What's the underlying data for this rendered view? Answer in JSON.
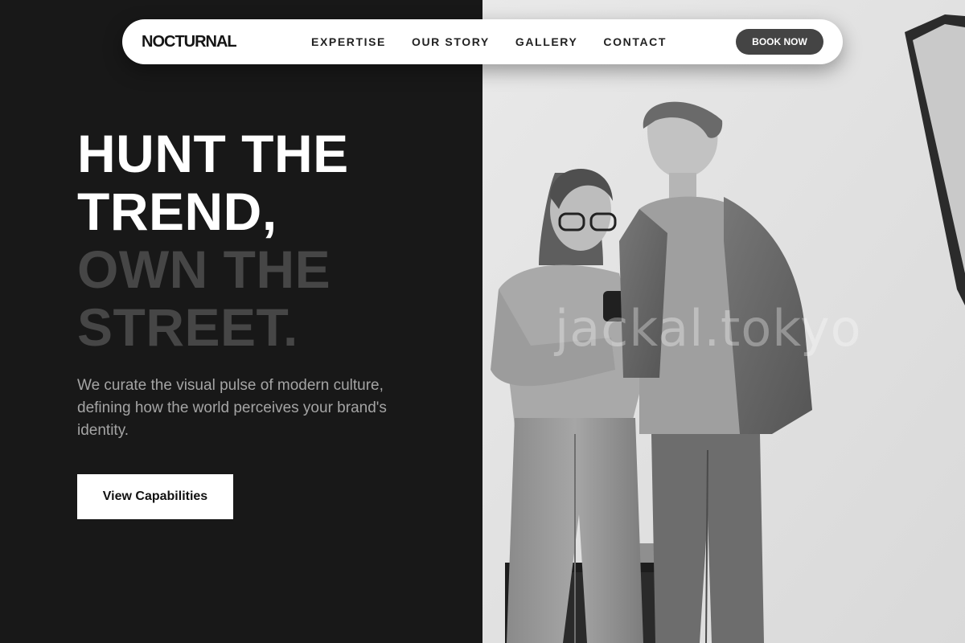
{
  "brand": {
    "name": "NOCTURNAL"
  },
  "nav": {
    "links": [
      "EXPERTISE",
      "OUR STORY",
      "GALLERY",
      "CONTACT"
    ],
    "cta_label": "BOOK NOW"
  },
  "hero": {
    "title_lines_light": [
      "HUNT THE",
      "TREND,"
    ],
    "title_lines_dim": [
      "OWN THE",
      "STREET."
    ],
    "description": "We curate the visual pulse of modern culture, defining how the world perceives your brand's identity.",
    "cta_label": "View Capabilities"
  },
  "photo": {
    "watermark": "jackal.tokyo",
    "style": "greyscale"
  },
  "colors": {
    "background_dark": "#181818",
    "nav_background": "#ffffff",
    "book_button": "#444444",
    "title_light": "#ffffff",
    "title_dim": "#464646",
    "description_text": "#a4a4a4"
  }
}
